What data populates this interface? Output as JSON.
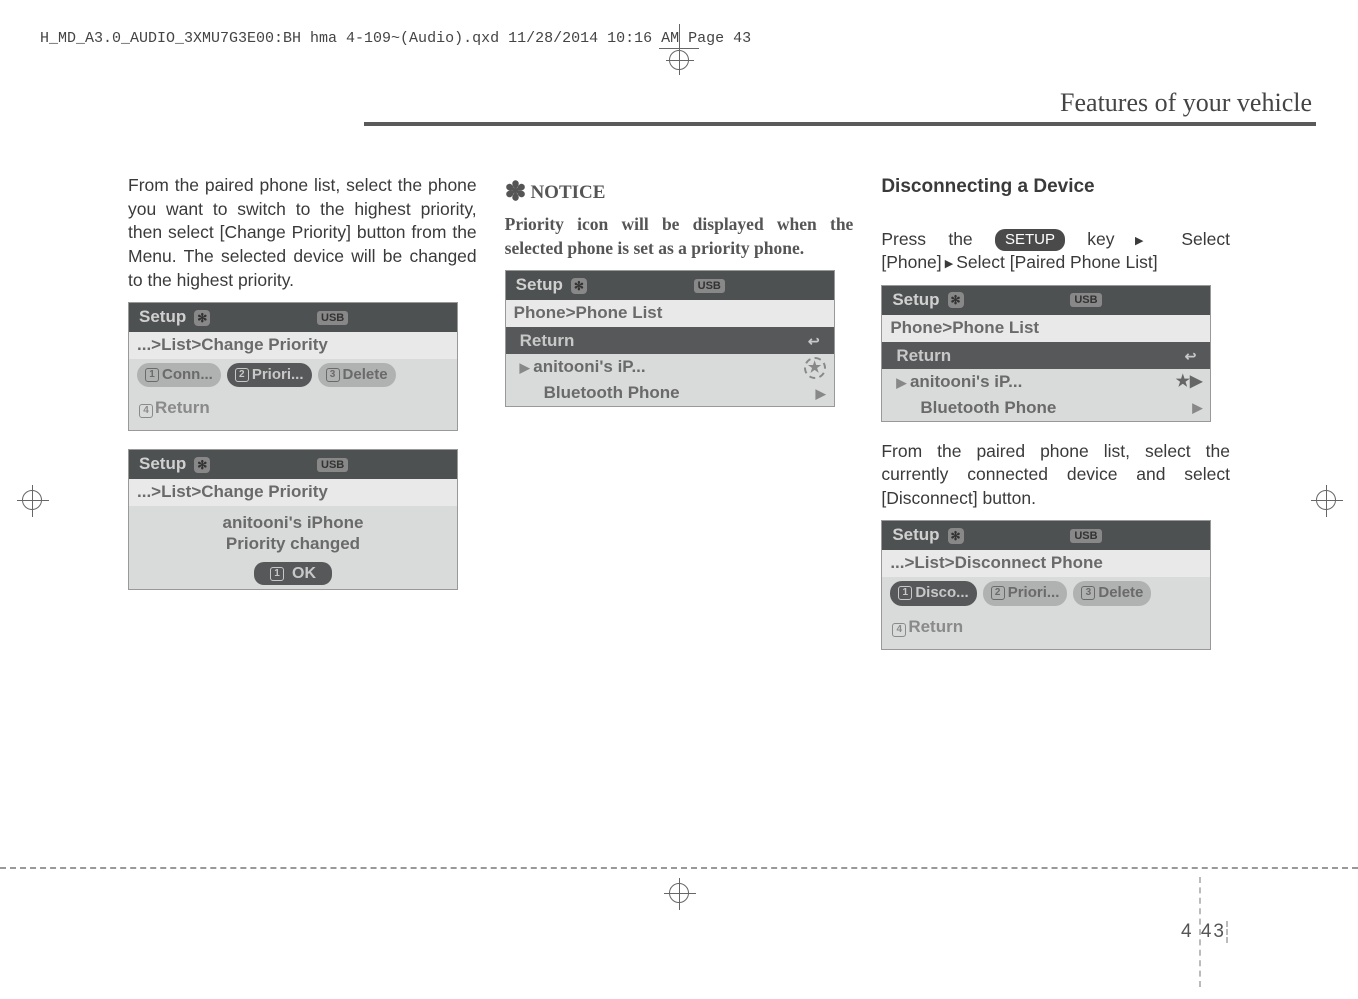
{
  "meta_top": "H_MD_A3.0_AUDIO_3XMU7G3E00:BH hma 4-109~(Audio).qxd  11/28/2014  10:16 AM  Page 43",
  "page_title": "Features of your vehicle",
  "col1": {
    "para": "From the paired phone list, select the phone you want to switch to the highest priority, then select [Change Priority] button from the Menu. The selected device will be changed to the highest priority.",
    "screen1": {
      "setup": "Setup",
      "usb": "USB",
      "sub": "...>List>Change Priority",
      "p1": "Conn...",
      "p2": "Priori...",
      "p3": "Delete",
      "ret": "Return"
    },
    "screen2": {
      "setup": "Setup",
      "usb": "USB",
      "sub": "...>List>Change Priority",
      "line1": "anitooni's iPhone",
      "line2": "Priority changed",
      "ok": "OK"
    }
  },
  "col2": {
    "notice_head": "NOTICE",
    "notice_body": "Priority icon will be displayed when the selected phone is set as a priority phone.",
    "screen": {
      "setup": "Setup",
      "usb": "USB",
      "sub": "Phone>Phone List",
      "ret": "Return",
      "row1": "anitooni's iP...",
      "row2": "Bluetooth Phone"
    }
  },
  "col3": {
    "heading": "Disconnecting a Device",
    "press_line_a": "Press the ",
    "setup_btn": "SETUP",
    "press_line_b": " key",
    "select1": "Select [Phone]",
    "select2": "Select [Paired Phone List]",
    "screen1": {
      "setup": "Setup",
      "usb": "USB",
      "sub": "Phone>Phone List",
      "ret": "Return",
      "row1": "anitooni's iP...",
      "row2": "Bluetooth Phone"
    },
    "para2": "From the paired phone list, select the currently connected device and select [Disconnect] button.",
    "screen2": {
      "setup": "Setup",
      "usb": "USB",
      "sub": "...>List>Disconnect Phone",
      "p1": "Disco...",
      "p2": "Priori...",
      "p3": "Delete",
      "ret": "Return"
    }
  },
  "page_num_chapter": "4",
  "page_num_page": "43"
}
